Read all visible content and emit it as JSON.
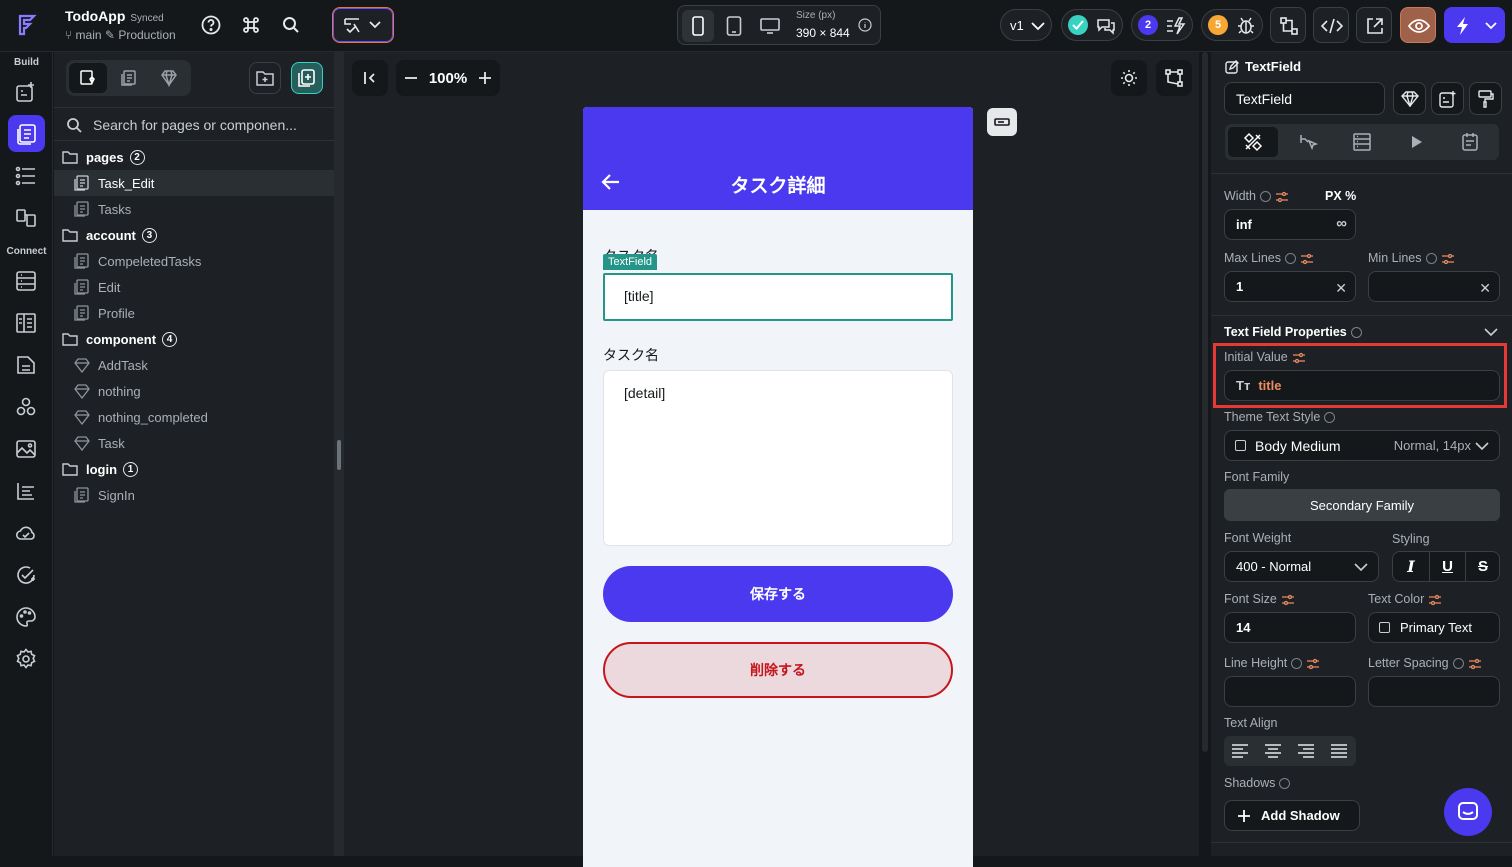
{
  "app": {
    "name": "TodoApp",
    "sync_status": "Synced",
    "branch": "main",
    "environment": "Production"
  },
  "device": {
    "size_label": "Size (px)",
    "size_value": "390 × 844"
  },
  "version": {
    "label": "v1"
  },
  "badges": {
    "collab_count": "2",
    "issues_count": "5"
  },
  "rail": {
    "build_label": "Build",
    "connect_label": "Connect"
  },
  "tree": {
    "search_placeholder": "Search for pages or componen...",
    "folders": [
      {
        "name": "pages",
        "count": "2",
        "items": [
          "Task_Edit",
          "Tasks"
        ]
      },
      {
        "name": "account",
        "count": "3",
        "items": [
          "CompeletedTasks",
          "Edit",
          "Profile"
        ]
      },
      {
        "name": "component",
        "count": "4",
        "items": [
          "AddTask",
          "nothing",
          "nothing_completed",
          "Task"
        ]
      },
      {
        "name": "login",
        "count": "1",
        "items": [
          "SignIn"
        ]
      }
    ],
    "selected": "Task_Edit"
  },
  "canvas": {
    "zoom": "100%"
  },
  "phone": {
    "title": "タスク詳細",
    "field1_label": "タスク名",
    "field1_value": "[title]",
    "field1_tag": "TextField",
    "field2_label": "タスク名",
    "field2_value": "[detail]",
    "save_button": "保存する",
    "delete_button": "削除する"
  },
  "panel": {
    "header": "TextField",
    "name_value": "TextField",
    "width_label": "Width",
    "width_units": "PX %",
    "width_value": "inf",
    "width_inf_symbol": "∞",
    "max_lines_label": "Max Lines",
    "max_lines_value": "1",
    "min_lines_label": "Min Lines",
    "min_lines_value": "",
    "section_title": "Text Field Properties",
    "initial_value_label": "Initial Value",
    "initial_value": "title",
    "theme_style_label": "Theme Text Style",
    "theme_style_value": "Body Medium",
    "theme_style_meta": "Normal, 14px",
    "font_family_label": "Font Family",
    "font_family_value": "Secondary Family",
    "font_weight_label": "Font Weight",
    "font_weight_value": "400 - Normal",
    "styling_label": "Styling",
    "font_size_label": "Font Size",
    "font_size_value": "14",
    "text_color_label": "Text Color",
    "text_color_value": "Primary Text",
    "line_height_label": "Line Height",
    "letter_spacing_label": "Letter Spacing",
    "text_align_label": "Text Align",
    "shadows_label": "Shadows",
    "add_shadow": "Add Shadow"
  },
  "colors": {
    "accent": "#4b39ef",
    "teal": "#249689",
    "danger": "#c4161c",
    "highlight": "#e53935",
    "orange_binding": "#ee8b60"
  }
}
